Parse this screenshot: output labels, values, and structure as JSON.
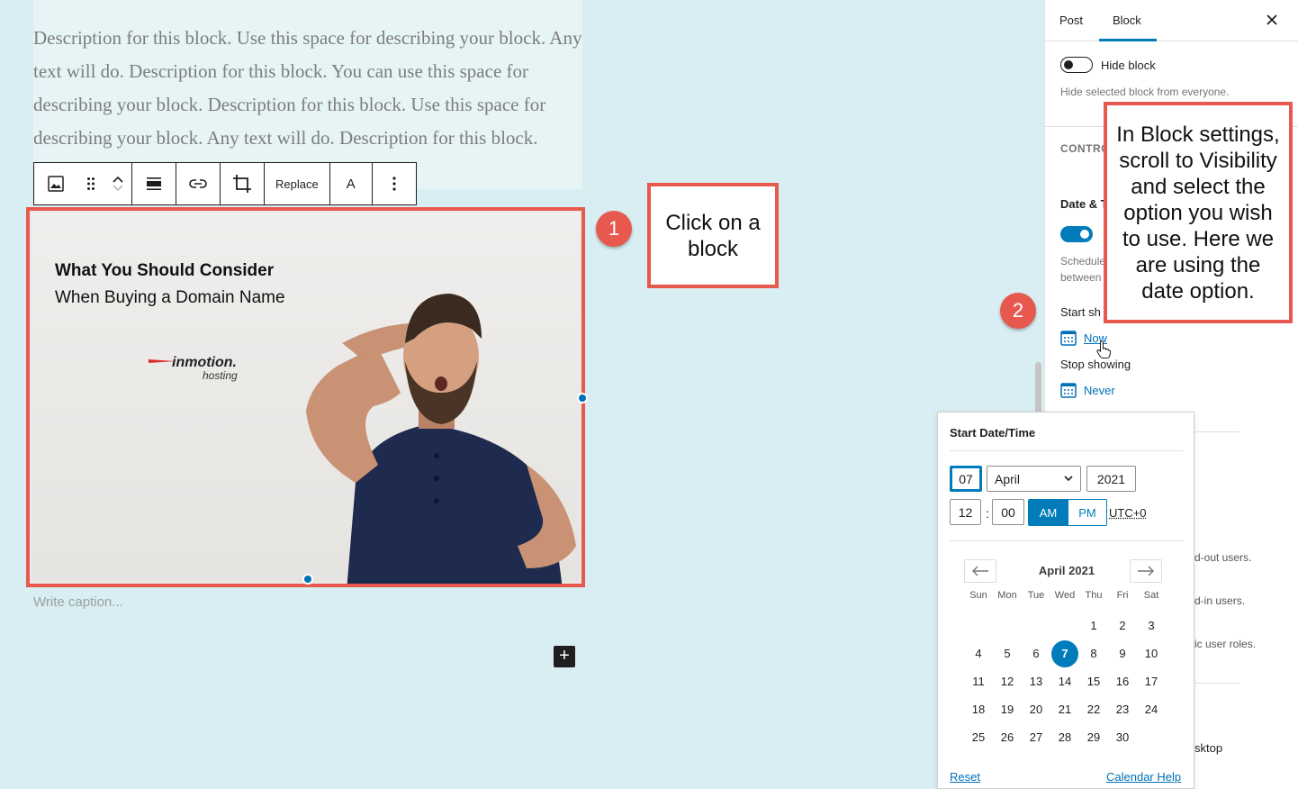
{
  "editor": {
    "paragraph": "Description for this block. Use this space for describing your block. Any text will do. Description for this block. You can use this space for describing your block. Description for this block. Use this space for describing your block. Any text will do. Description for this block.",
    "toolbar": {
      "replace_label": "Replace",
      "text_label": "A"
    },
    "image": {
      "headline_bold": "What You Should Consider",
      "headline_regular": "When Buying  a Domain Name",
      "brand_name": "inmotion.",
      "brand_sub": "hosting"
    },
    "caption_placeholder": "Write caption...",
    "inserter_label": "+"
  },
  "annotations": {
    "step1_number": "1",
    "step1_text": "Click on a block",
    "step2_number": "2",
    "step2_text": "In Block settings, scroll to Visibility and select the option you wish to use.  Here we are using the date option."
  },
  "sidebar": {
    "tabs": [
      "Post",
      "Block"
    ],
    "active_tab": "Block",
    "close_icon": "close-icon",
    "hide_block_label": "Hide block",
    "hide_block_help": "Hide selected block from everyone.",
    "controls_heading_partial": "CONTRO",
    "date_time_partial": "Date & T",
    "schedule_help_partial_1": "Schedule",
    "schedule_help_partial_2": "between",
    "start_showing_partial": "Start sh",
    "start_showing_value": "Now",
    "stop_showing_label": "Stop showing",
    "stop_showing_value": "Never",
    "hidden_rows_partial": [
      "d-out users.",
      "d-in users.",
      "ic user roles.",
      "sktop"
    ]
  },
  "date_picker": {
    "title": "Start Date/Time",
    "day": "07",
    "month": "April",
    "year": "2021",
    "hour": "12",
    "minute": "00",
    "time_separator": ":",
    "am_label": "AM",
    "pm_label": "PM",
    "selected_meridiem": "AM",
    "timezone": "UTC+0",
    "calendar_title": "April 2021",
    "weekdays": [
      "Sun",
      "Mon",
      "Tue",
      "Wed",
      "Thu",
      "Fri",
      "Sat"
    ],
    "first_weekday_index": 4,
    "days_in_month": 30,
    "selected_day": 7,
    "reset_label": "Reset",
    "help_label": "Calendar Help",
    "prev_icon": "arrow-left-icon",
    "next_icon": "arrow-right-icon"
  },
  "colors": {
    "accent": "#007cba",
    "annotation_red": "#e7594e",
    "canvas_bg": "#d8eef2"
  }
}
